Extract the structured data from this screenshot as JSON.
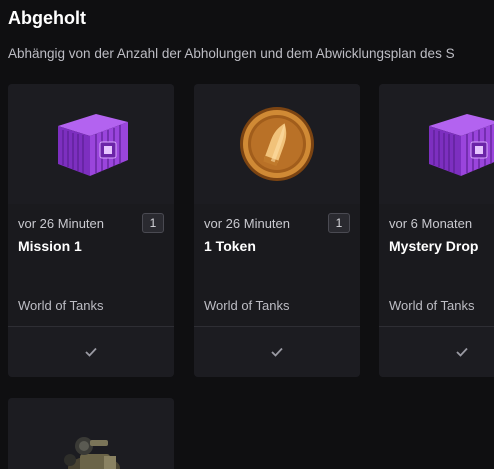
{
  "header": {
    "title": "Abgeholt",
    "subtitle": "Abhängig von der Anzahl der Abholungen und dem Abwicklungsplan des S"
  },
  "cards": [
    {
      "image_icon": "purple-container-icon",
      "time": "vor 26 Minuten",
      "count": "1",
      "name": "Mission 1",
      "game": "World of Tanks",
      "status_icon": "check-icon"
    },
    {
      "image_icon": "gold-token-icon",
      "time": "vor 26 Minuten",
      "count": "1",
      "name": "1 Token",
      "game": "World of Tanks",
      "status_icon": "check-icon"
    },
    {
      "image_icon": "purple-container-icon",
      "time": "vor 6 Monaten",
      "count": "",
      "name": "Mystery Drop",
      "game": "World of Tanks",
      "status_icon": "check-icon"
    },
    {
      "image_icon": "vehicle-item-icon"
    }
  ],
  "colors": {
    "background": "#0f0f11",
    "card": "#1c1c21",
    "container_purple": "#8a3fd0",
    "token_gold": "#c98a32"
  }
}
